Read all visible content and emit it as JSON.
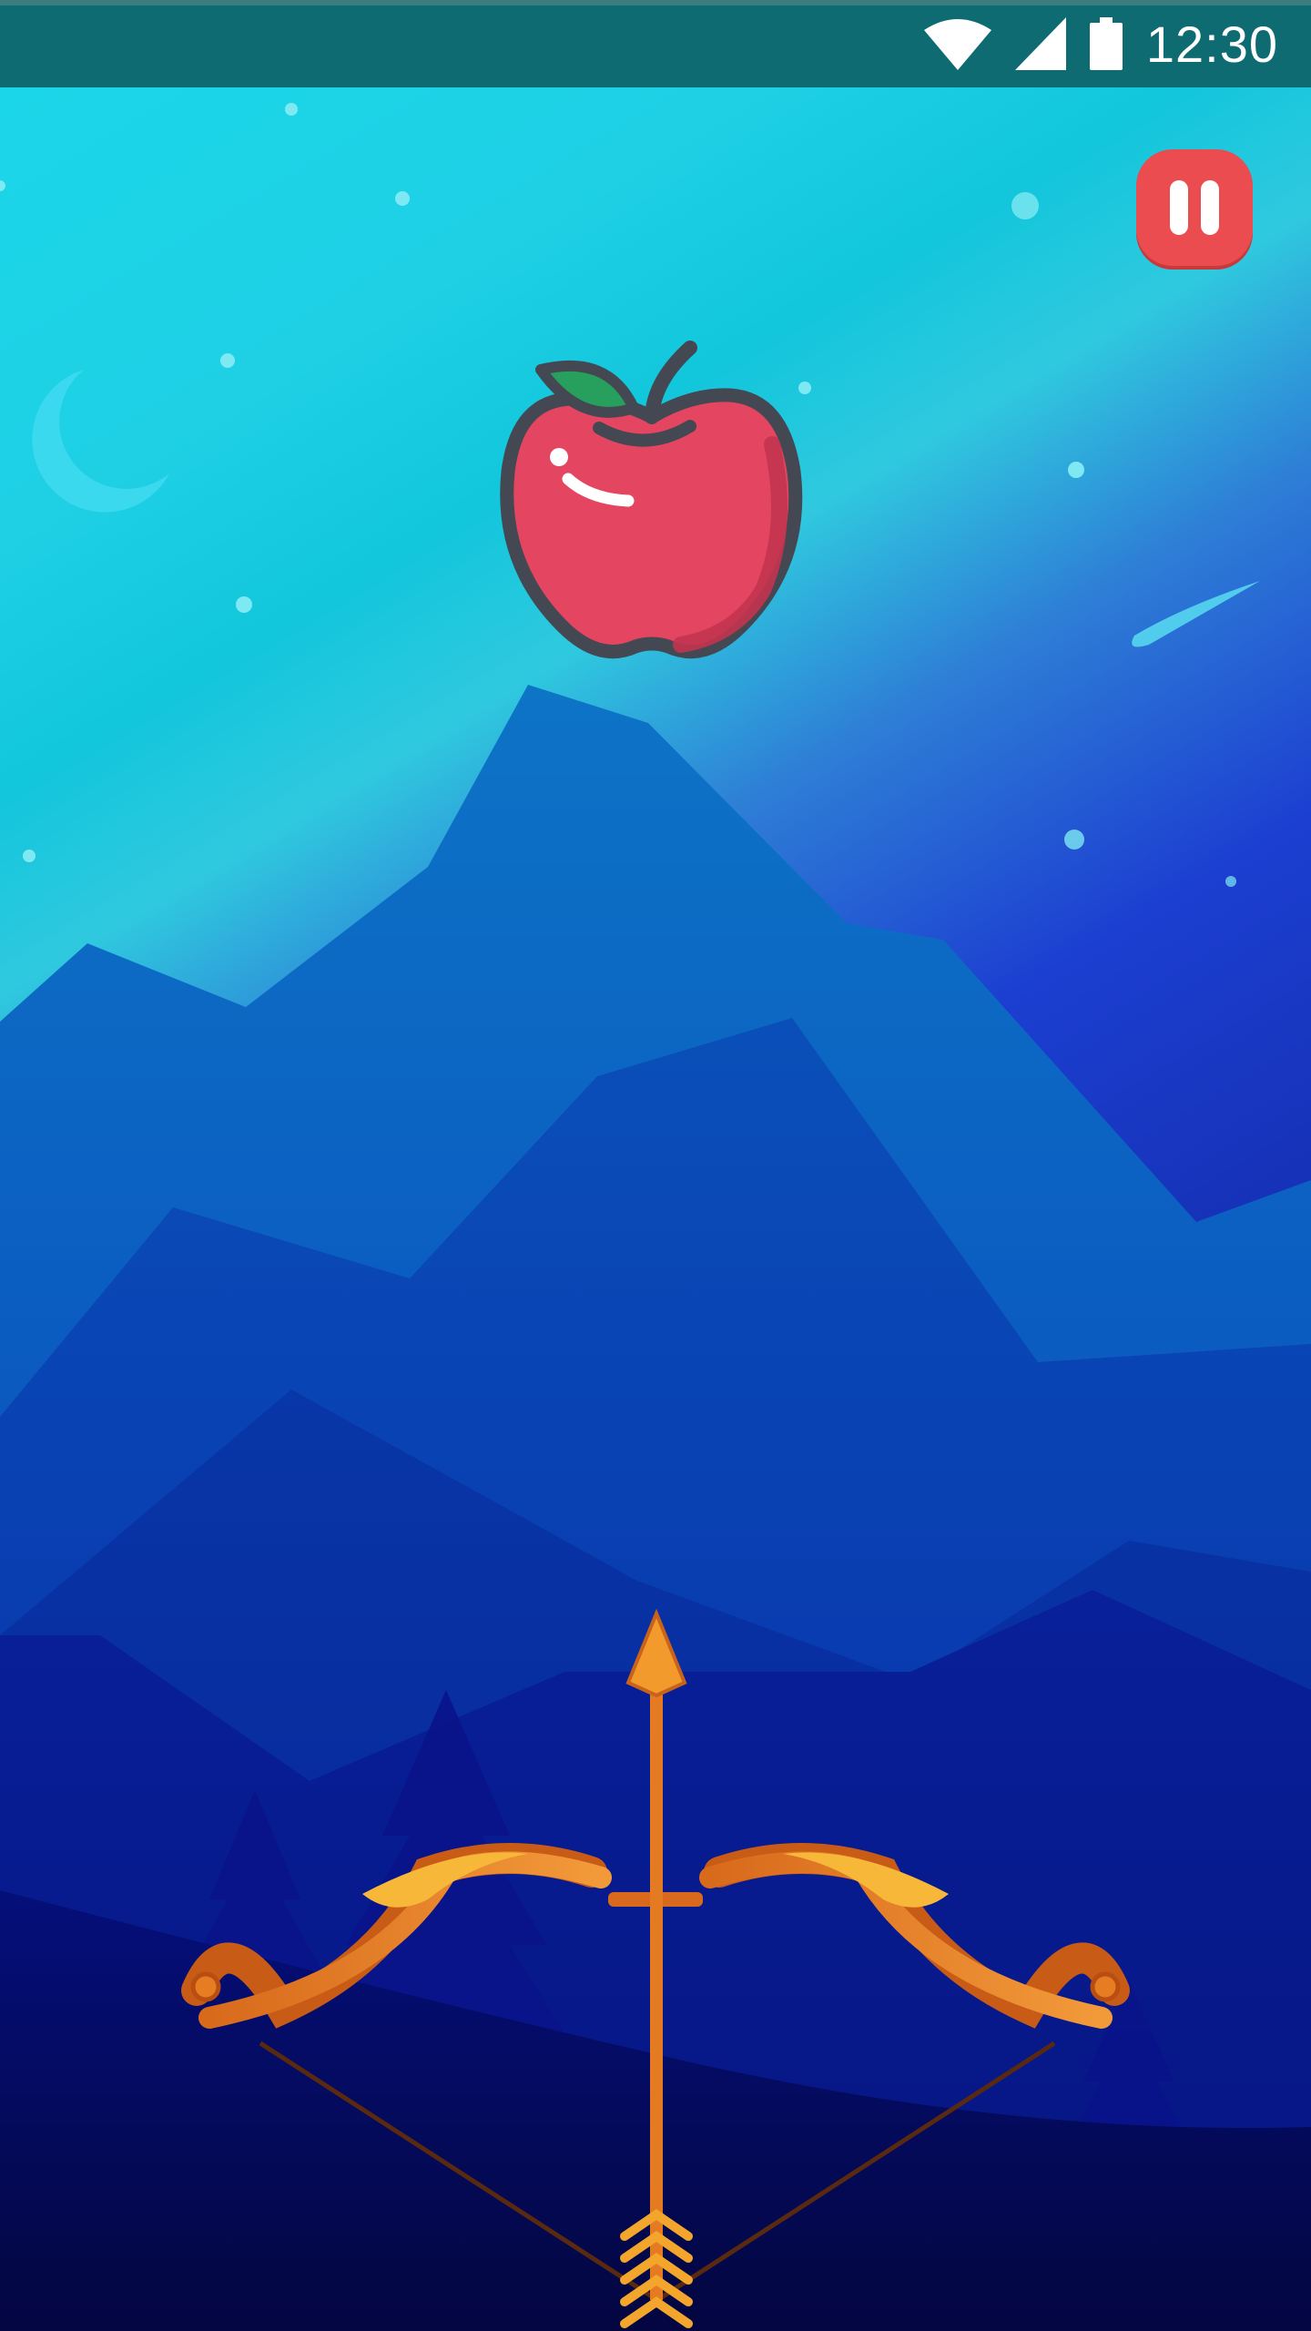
{
  "status_bar": {
    "time": "12:30",
    "icons": [
      "wifi-icon",
      "cellular-signal-icon",
      "battery-icon"
    ],
    "background": "#0f6b72"
  },
  "game": {
    "target": "apple",
    "weapon": "bow-and-arrow",
    "controls": {
      "pause_icon": "pause-icon",
      "pause_color": "#ea4c4f"
    },
    "background_theme": "night-mountains",
    "colors": {
      "sky_top": "#19d3e6",
      "sky_bottom": "#1e3fcf",
      "ground": "#04064a"
    }
  }
}
